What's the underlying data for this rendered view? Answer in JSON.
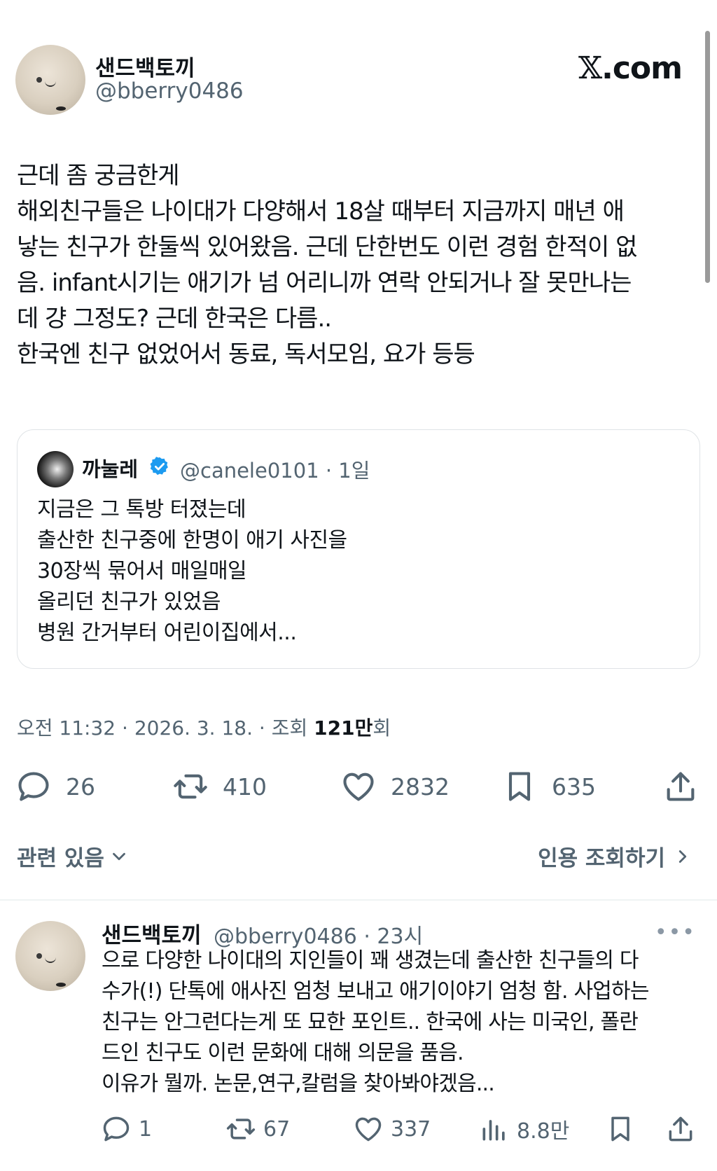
{
  "header": {
    "display_name": "샌드백토끼",
    "handle": "@bberry0486",
    "site_logo_x": "𝕏",
    "site_logo_rest": ".com"
  },
  "tweet": {
    "lines": [
      "근데 좀 궁금한게",
      "해외친구들은 나이대가 다양해서 18살 때부터 지금까지 매년 애",
      "낳는 친구가 한둘씩 있어왔음. 근데 단한번도 이런 경험 한적이 없",
      "음. infant시기는 애기가 넘 어리니까 연락 안되거나 잘 못만나는",
      "데 걍 그정도? 근데 한국은 다름..",
      "한국엔 친구 없었어서 동료, 독서모임, 요가 등등"
    ]
  },
  "quote": {
    "display_name": "까눌레",
    "handle_and_time": "@canele0101 · 1일",
    "lines": [
      "지금은 그 톡방 터졌는데",
      "출산한 친구중에 한명이 애기 사진을",
      "30장씩 묶어서 매일매일",
      "올리던 친구가 있었음",
      "병원 간거부터 어린이집에서..."
    ]
  },
  "meta": {
    "time_date": "오전 11:32 · 2026. 3. 18. · 조회 ",
    "views": "121만",
    "views_suffix": "회"
  },
  "actions": {
    "replies": "26",
    "reposts": "410",
    "likes": "2832",
    "bookmarks": "635"
  },
  "related": {
    "label": "관련 있음",
    "quotes_label": "인용 조회하기"
  },
  "reply": {
    "display_name": "샌드백토끼",
    "handle_and_time": "@bberry0486 · 23시",
    "more": "•••",
    "lines": [
      "으로 다양한 나이대의 지인들이 꽤 생겼는데 출산한 친구들의 다",
      "수가(!) 단톡에 애사진 엄청 보내고 애기이야기 엄청 함. 사업하는",
      "친구는 안그런다는게 또 묘한 포인트.. 한국에 사는 미국인, 폴란",
      "드인 친구도 이런 문화에 대해 의문을 품음.",
      "이유가 뭘까. 논문,연구,칼럼을 찾아봐야겠음..."
    ],
    "actions": {
      "replies": "1",
      "reposts": "67",
      "likes": "337",
      "views": "8.8만"
    }
  },
  "colors": {
    "text": "#0f1419",
    "secondary": "#536471",
    "verified": "#1d9bf0",
    "border": "#dfe3e6"
  }
}
